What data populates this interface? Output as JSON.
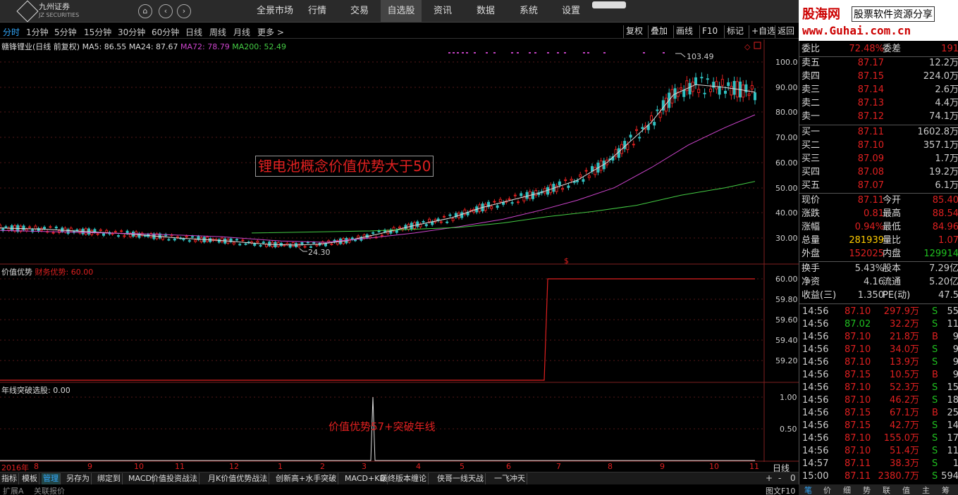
{
  "top_nav": {
    "logo_title": "九州证券",
    "logo_sub": "JZ SECURITIES",
    "items": [
      "全景市场",
      "行情",
      "交易",
      "自选股",
      "资讯",
      "数据",
      "系统",
      "设置"
    ],
    "active": "自选股"
  },
  "brand": {
    "name": "股海网",
    "slogan": "股票软件资源分享",
    "url": "www.Guhai.com.cn"
  },
  "periods": [
    "分时",
    "1分钟",
    "5分钟",
    "15分钟",
    "30分钟",
    "60分钟",
    "日线",
    "周线",
    "月线",
    "更多 >"
  ],
  "tools": [
    "复权",
    "叠加",
    "画线",
    "F10",
    "标记",
    "+自选",
    "返回"
  ],
  "chart": {
    "title": "赣锋锂业(日线 前复权)",
    "ma": [
      {
        "label": "MA5: 86.55",
        "color": "#dddddd"
      },
      {
        "label": "MA24: 87.67",
        "color": "#dddddd"
      },
      {
        "label": "MA72: 78.79",
        "color": "#cc44cc"
      },
      {
        "label": "MA200: 52.49",
        "color": "#44cc44"
      }
    ],
    "y_ticks": [
      "100.0",
      "90.00",
      "80.00",
      "70.00",
      "60.00",
      "50.00",
      "40.00",
      "30.00"
    ],
    "high_label": "103.49",
    "low_label": "24.30",
    "annotation": "锂电池概念价值优势大于50",
    "signal_mark": "$"
  },
  "indicator2": {
    "name": "价值优势",
    "sub": "财务优势: 60.00",
    "y_ticks": [
      "60.00",
      "59.80",
      "59.60",
      "59.40",
      "59.20"
    ]
  },
  "indicator3": {
    "name": "年线突破选股",
    "value": ": 0.00",
    "y_ticks": [
      "1.00",
      "0.50"
    ],
    "annotation": "价值优势57+突破年线"
  },
  "date_axis": {
    "year": "2016年",
    "months": [
      "8",
      "9",
      "10",
      "11",
      "12",
      "1",
      "2",
      "3",
      "4",
      "5",
      "6",
      "7",
      "8",
      "9",
      "10",
      "11"
    ],
    "period_label": "日线"
  },
  "bottom_tabs": [
    "指标",
    "模板",
    "管理",
    "另存为",
    "绑定到",
    "MACD",
    "价值投资战法",
    "月K价值优势战法",
    "创新高+水手突破",
    "MACD+KD",
    "最终版本缠论",
    "侠哥一线天战",
    "一飞冲天"
  ],
  "bottom_tabs_active": "管理",
  "bottom_row": [
    "扩展A",
    "关联报价"
  ],
  "quote": {
    "weibi": {
      "l": "委比",
      "v": "72.48%",
      "l2": "委差",
      "v2": "191"
    },
    "sell": [
      {
        "l": "卖五",
        "p": "87.17",
        "v": "12.2万"
      },
      {
        "l": "卖四",
        "p": "87.15",
        "v": "224.0万"
      },
      {
        "l": "卖三",
        "p": "87.14",
        "v": "2.6万"
      },
      {
        "l": "卖二",
        "p": "87.13",
        "v": "4.4万"
      },
      {
        "l": "卖一",
        "p": "87.12",
        "v": "74.1万"
      }
    ],
    "buy": [
      {
        "l": "买一",
        "p": "87.11",
        "v": "1602.8万"
      },
      {
        "l": "买二",
        "p": "87.10",
        "v": "357.1万"
      },
      {
        "l": "买三",
        "p": "87.09",
        "v": "1.7万"
      },
      {
        "l": "买四",
        "p": "87.08",
        "v": "19.2万"
      },
      {
        "l": "买五",
        "p": "87.07",
        "v": "6.1万"
      }
    ],
    "stats": [
      {
        "l": "现价",
        "v": "87.11",
        "l2": "今开",
        "v2": "85.40"
      },
      {
        "l": "涨跌",
        "v": "0.81",
        "l2": "最高",
        "v2": "88.54"
      },
      {
        "l": "涨幅",
        "v": "0.94%",
        "l2": "最低",
        "v2": "84.96"
      },
      {
        "l": "总量",
        "v": "281939",
        "l2": "量比",
        "v2": "1.07"
      },
      {
        "l": "外盘",
        "v": "152025",
        "l2": "内盘",
        "v2": "129914"
      }
    ],
    "stats2": [
      {
        "l": "换手",
        "v": "5.43%",
        "l2": "股本",
        "v2": "7.29亿"
      },
      {
        "l": "净资",
        "v": "4.16",
        "l2": "流通",
        "v2": "5.20亿"
      },
      {
        "l": "收益(三)",
        "v": "1.350",
        "l2": "PE(动)",
        "v2": "47.5"
      }
    ],
    "ticks": [
      {
        "t": "14:56",
        "p": "87.10",
        "v": "297.9万",
        "f": "S",
        "c": "55"
      },
      {
        "t": "14:56",
        "p": "87.02",
        "v": "32.2万",
        "f": "S",
        "c": "11"
      },
      {
        "t": "14:56",
        "p": "87.10",
        "v": "21.8万",
        "f": "B",
        "c": "9"
      },
      {
        "t": "14:56",
        "p": "87.10",
        "v": "34.0万",
        "f": "S",
        "c": "9"
      },
      {
        "t": "14:56",
        "p": "87.10",
        "v": "13.9万",
        "f": "S",
        "c": "9"
      },
      {
        "t": "14:56",
        "p": "87.15",
        "v": "10.5万",
        "f": "B",
        "c": "9"
      },
      {
        "t": "14:56",
        "p": "87.10",
        "v": "52.3万",
        "f": "S",
        "c": "15"
      },
      {
        "t": "14:56",
        "p": "87.10",
        "v": "46.2万",
        "f": "S",
        "c": "18"
      },
      {
        "t": "14:56",
        "p": "87.15",
        "v": "67.1万",
        "f": "B",
        "c": "25"
      },
      {
        "t": "14:56",
        "p": "87.15",
        "v": "42.7万",
        "f": "S",
        "c": "14"
      },
      {
        "t": "14:56",
        "p": "87.10",
        "v": "155.0万",
        "f": "S",
        "c": "17"
      },
      {
        "t": "14:56",
        "p": "87.10",
        "v": "51.4万",
        "f": "S",
        "c": "11"
      },
      {
        "t": "14:57",
        "p": "87.11",
        "v": "38.3万",
        "f": "S",
        "c": "1"
      },
      {
        "t": "15:00",
        "p": "87.11",
        "v": "2380.7万",
        "f": "S",
        "c": "594"
      }
    ]
  },
  "quote_tabs": [
    "笔",
    "价",
    "细",
    "势",
    "联",
    "值",
    "主",
    "筹"
  ],
  "bottom_right": [
    "图文F10",
    "+",
    "-",
    "0"
  ],
  "colors": {
    "up": "#e02020",
    "down": "#20c020",
    "ma5": "#dddddd",
    "ma72": "#cc44cc",
    "ma200": "#44cc44",
    "accent": "#3399ff"
  },
  "chart_data": {
    "type": "line",
    "y_range": [
      20,
      106
    ],
    "series": [
      {
        "name": "MA24",
        "values": [
          [
            0,
            34
          ],
          [
            30,
            33.5
          ],
          [
            60,
            32.5
          ],
          [
            90,
            31.5
          ],
          [
            120,
            30
          ],
          [
            150,
            29
          ],
          [
            180,
            27.5
          ],
          [
            200,
            27.2
          ],
          [
            215,
            27.5
          ],
          [
            235,
            29
          ],
          [
            255,
            31.5
          ],
          [
            280,
            35
          ],
          [
            305,
            38
          ],
          [
            325,
            42
          ],
          [
            345,
            45
          ],
          [
            365,
            48
          ],
          [
            390,
            53
          ],
          [
            410,
            60
          ],
          [
            425,
            68
          ],
          [
            440,
            76
          ],
          [
            455,
            87
          ],
          [
            470,
            91
          ],
          [
            488,
            90
          ],
          [
            500,
            89
          ],
          [
            510,
            88
          ]
        ]
      },
      {
        "name": "MA72",
        "values": [
          [
            0,
            33
          ],
          [
            50,
            32.3
          ],
          [
            100,
            31.6
          ],
          [
            150,
            30.5
          ],
          [
            190,
            28.8
          ],
          [
            220,
            28.3
          ],
          [
            250,
            30
          ],
          [
            280,
            32
          ],
          [
            310,
            34.5
          ],
          [
            340,
            37.5
          ],
          [
            365,
            41
          ],
          [
            390,
            45
          ],
          [
            415,
            50
          ],
          [
            440,
            58
          ],
          [
            465,
            67
          ],
          [
            490,
            74
          ],
          [
            510,
            79
          ]
        ]
      },
      {
        "name": "MA200",
        "values": [
          [
            170,
            32
          ],
          [
            220,
            32.5
          ],
          [
            250,
            32.8
          ],
          [
            280,
            33.5
          ],
          [
            310,
            34.2
          ],
          [
            340,
            36
          ],
          [
            370,
            38.5
          ],
          [
            400,
            40.5
          ],
          [
            430,
            43
          ],
          [
            460,
            47
          ],
          [
            490,
            50
          ],
          [
            510,
            52.5
          ]
        ]
      }
    ]
  }
}
